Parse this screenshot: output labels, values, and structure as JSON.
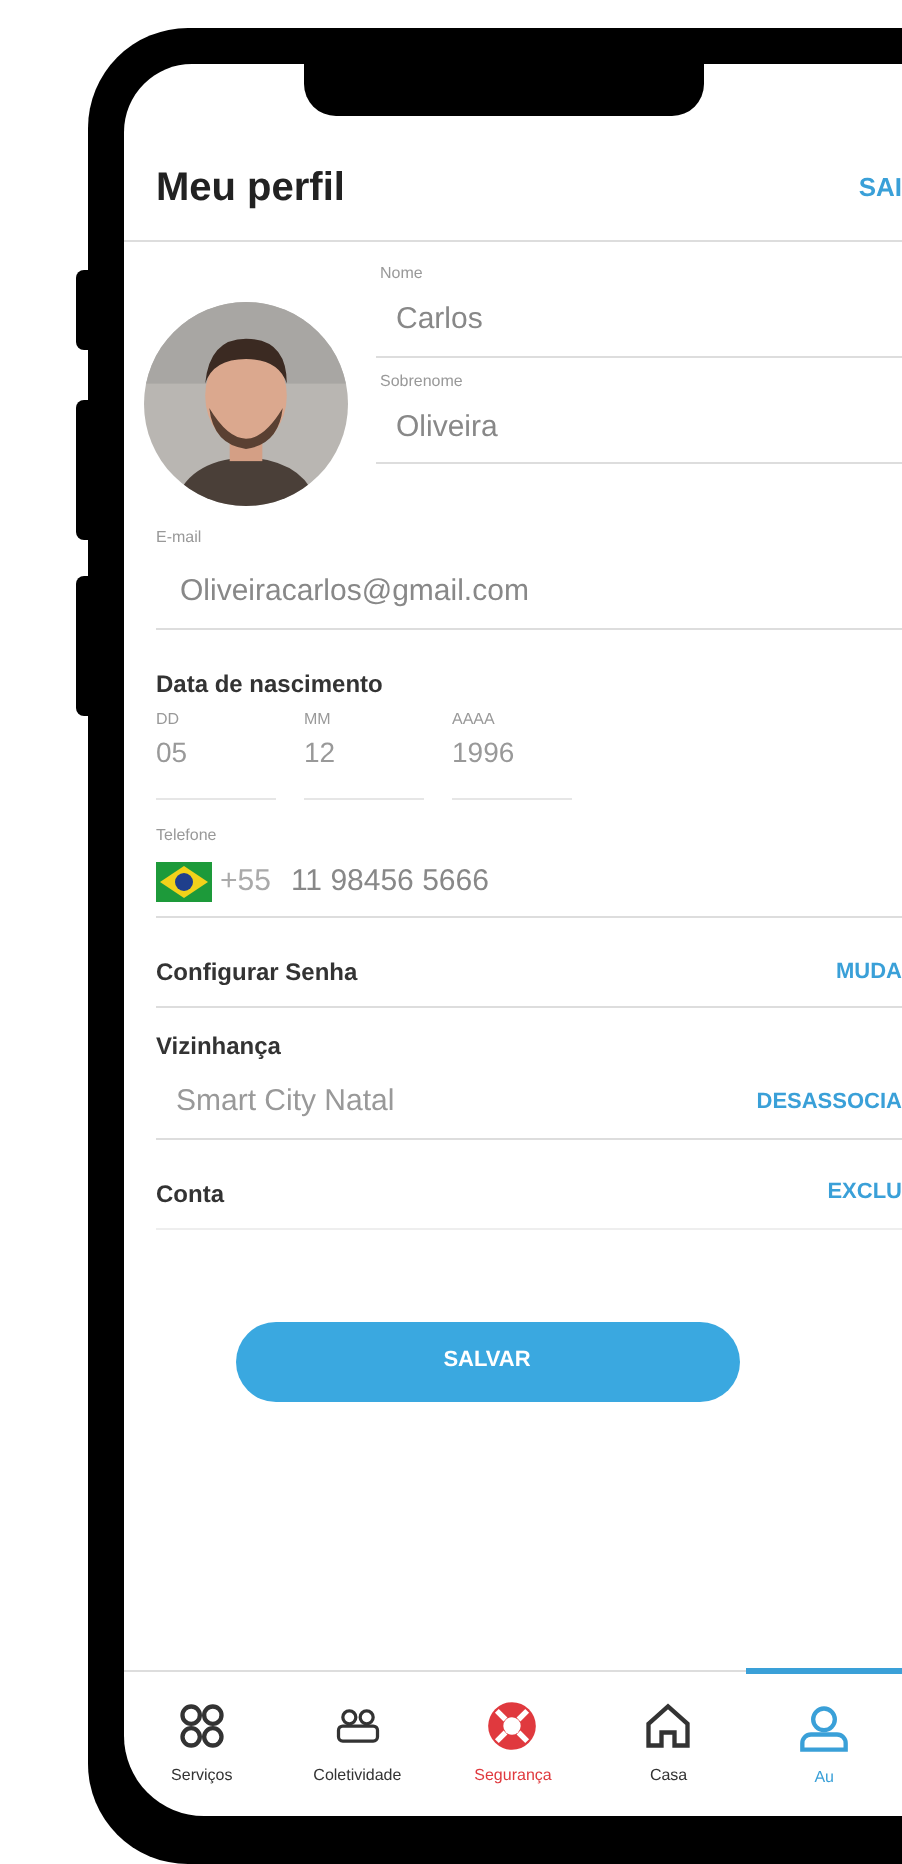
{
  "header": {
    "title": "Meu perfil",
    "action": "SAI"
  },
  "name_fields": [
    {
      "label": "Nome",
      "value": "Carlos"
    },
    {
      "label": "Sobrenome",
      "value": "Oliveira"
    }
  ],
  "email": {
    "label": "E-mail",
    "value": "Oliveiracarlos@gmail.com"
  },
  "birth": {
    "title": "Data de nascimento",
    "parts": [
      {
        "label": "DD",
        "value": "05"
      },
      {
        "label": "MM",
        "value": "12"
      },
      {
        "label": "AAAA",
        "value": "1996"
      }
    ]
  },
  "phone": {
    "label": "Telefone",
    "code": "+55",
    "value": "11 98456 5666"
  },
  "password": {
    "label": "Configurar Senha",
    "action": "MUDA"
  },
  "neighborhood": {
    "label": "Vizinhança",
    "value": "Smart City Natal",
    "action": "DESASSOCIA"
  },
  "account": {
    "label": "Conta",
    "action": "EXCLU"
  },
  "save_button": "SALVAR",
  "nav": [
    {
      "label": "Serviços",
      "color": "#333333",
      "selected": false
    },
    {
      "label": "Coletividade",
      "color": "#333333",
      "selected": false
    },
    {
      "label": "Segurança",
      "color": "#e0393e",
      "selected": false
    },
    {
      "label": "Casa",
      "color": "#333333",
      "selected": false
    },
    {
      "label": "Au",
      "color": "#3aa0d8",
      "selected": true
    }
  ]
}
